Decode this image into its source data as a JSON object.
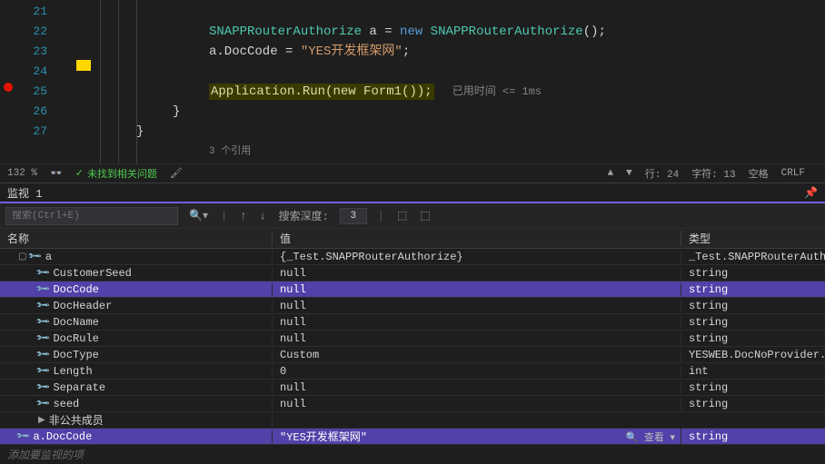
{
  "editor": {
    "lines": {
      "21": "",
      "22_type": "SNAPPRouterAuthorize",
      "22_var": " a = ",
      "22_new": "new",
      "22_type2": " SNAPPRouterAuthorize",
      "22_end": "();",
      "23_pre": "a.DocCode = ",
      "23_str": "\"YES开发框架网\"",
      "23_end": ";",
      "24": "",
      "25_app": "Application",
      "25_run": ".Run(",
      "25_new": "new",
      "25_form": " Form1",
      "25_end": "());",
      "25_timing": "已用时间 <= 1ms",
      "26": "}",
      "27": "}",
      "refs": "3 个引用"
    },
    "line_numbers": [
      "21",
      "22",
      "23",
      "24",
      "25",
      "26",
      "27"
    ]
  },
  "statusbar": {
    "zoom": "132 %",
    "issues": "未找到相关问题",
    "line": "行: 24",
    "col": "字符: 13",
    "tabs": "空格",
    "crlf": "CRLF"
  },
  "panel": {
    "title": "监视 1",
    "search_placeholder": "搜索(Ctrl+E)",
    "depth_label": "搜索深度:",
    "depth_value": "3"
  },
  "grid": {
    "headers": {
      "name": "名称",
      "value": "值",
      "type": "类型"
    },
    "rows": [
      {
        "level": 1,
        "icon": "wrench",
        "expand": "▢",
        "name": "a",
        "value": "{_Test.SNAPPRouterAuthorize}",
        "type": "_Test.SNAPPRouterAutho...",
        "selected": false
      },
      {
        "level": 2,
        "icon": "wrench",
        "name": "CustomerSeed",
        "value": "null",
        "type": "string",
        "selected": false
      },
      {
        "level": 2,
        "icon": "wrench",
        "name": "DocCode",
        "value": "null",
        "type": "string",
        "selected": true
      },
      {
        "level": 2,
        "icon": "wrench",
        "name": "DocHeader",
        "value": "null",
        "type": "string",
        "selected": false
      },
      {
        "level": 2,
        "icon": "wrench",
        "name": "DocName",
        "value": "null",
        "type": "string",
        "selected": false
      },
      {
        "level": 2,
        "icon": "wrench",
        "name": "DocRule",
        "value": "null",
        "type": "string",
        "selected": false
      },
      {
        "level": 2,
        "icon": "wrench",
        "name": "DocType",
        "value": "Custom",
        "type": "YESWEB.DocNoProvider....",
        "selected": false
      },
      {
        "level": 2,
        "icon": "wrench",
        "name": "Length",
        "value": "0",
        "type": "int",
        "selected": false
      },
      {
        "level": 2,
        "icon": "wrench",
        "name": "Separate",
        "value": "null",
        "type": "string",
        "selected": false
      },
      {
        "level": 2,
        "icon": "wrench",
        "name": "seed",
        "value": "null",
        "type": "string",
        "selected": false
      },
      {
        "level": 2,
        "icon": "",
        "expand": "▶",
        "name": "非公共成员",
        "value": "",
        "type": "",
        "selected": false
      },
      {
        "level": 1,
        "icon": "wrench",
        "name": "a.DocCode",
        "value": "\"YES开发框架网\"",
        "type": "string",
        "selected": true,
        "search": true
      }
    ],
    "add_watch": "添加要监视的项",
    "search_text": "查看"
  }
}
